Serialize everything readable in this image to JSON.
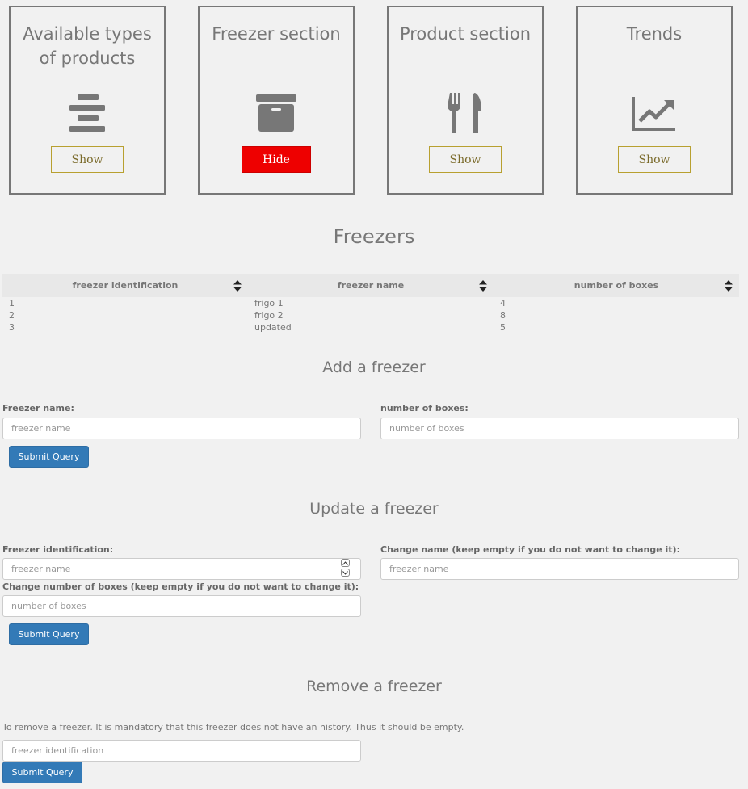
{
  "cards": [
    {
      "title": "Available types of products",
      "icon": "stacked-bars-icon",
      "button": "Show"
    },
    {
      "title": "Freezer section",
      "icon": "archive-box-icon",
      "button": "Hide"
    },
    {
      "title": "Product section",
      "icon": "fork-knife-icon",
      "button": "Show"
    },
    {
      "title": "Trends",
      "icon": "line-chart-icon",
      "button": "Show"
    }
  ],
  "freezers": {
    "heading": "Freezers",
    "columns": [
      "freezer identification",
      "freezer name",
      "number of boxes"
    ],
    "rows": [
      [
        "1",
        "frigo 1",
        "4"
      ],
      [
        "2",
        "frigo 2",
        "8"
      ],
      [
        "3",
        "updated",
        "5"
      ]
    ]
  },
  "add": {
    "heading": "Add a freezer",
    "name_label": "Freezer name:",
    "name_placeholder": "freezer name",
    "boxes_label": "number of boxes:",
    "boxes_placeholder": "number of boxes",
    "submit": "Submit Query"
  },
  "update": {
    "heading": "Update a freezer",
    "id_label": "Freezer identification:",
    "id_placeholder": "freezer name",
    "name_label": "Change name (keep empty if you do not want to change it):",
    "name_placeholder": "freezer name",
    "boxes_label": "Change number of boxes (keep empty if you do not want to change it):",
    "boxes_placeholder": "number of boxes",
    "submit": "Submit Query"
  },
  "remove": {
    "heading": "Remove a freezer",
    "note": "To remove a freezer. It is mandatory that this freezer does not have an history. Thus it should be empty.",
    "id_placeholder": "freezer identification",
    "submit": "Submit Query"
  },
  "colors": {
    "hide_button": "#ee0000",
    "submit_button": "#337ab7",
    "show_border": "#b8a030"
  }
}
